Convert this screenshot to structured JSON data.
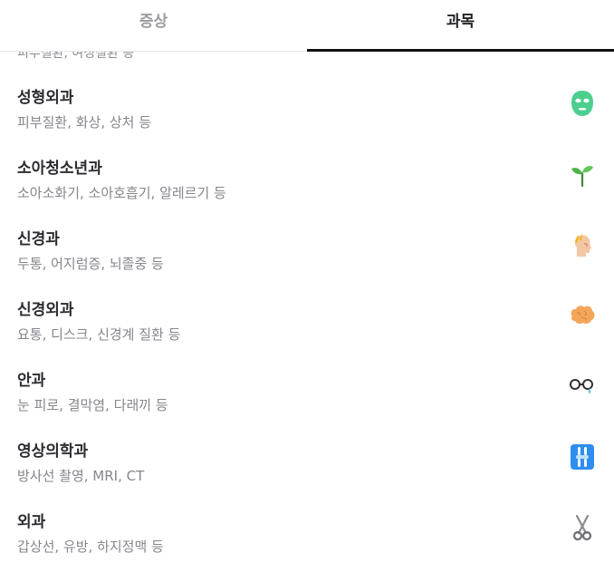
{
  "tabs": {
    "symptom": "증상",
    "department": "과목"
  },
  "partial_top": "피부질환, 여성질환 등",
  "departments": [
    {
      "name": "성형외과",
      "desc": "피부질환, 화상, 상처 등",
      "icon": "face-mask-icon"
    },
    {
      "name": "소아청소년과",
      "desc": "소아소화기, 소아호흡기, 알레르기 등",
      "icon": "sprout-icon"
    },
    {
      "name": "신경과",
      "desc": "두통, 어지럼증, 뇌졸중 등",
      "icon": "head-pain-icon"
    },
    {
      "name": "신경외과",
      "desc": "요통, 디스크, 신경계 질환 등",
      "icon": "brain-icon"
    },
    {
      "name": "안과",
      "desc": "눈 피로, 결막염, 다래끼 등",
      "icon": "eyeglasses-icon"
    },
    {
      "name": "영상의학과",
      "desc": "방사선 촬영, MRI, CT",
      "icon": "xray-icon"
    },
    {
      "name": "외과",
      "desc": "갑상선, 유방, 하지정맥 등",
      "icon": "scissors-icon"
    }
  ],
  "colors": {
    "active_tab_underline": "#111111",
    "inactive_tab_text": "#9b9ba1",
    "description_text": "#86868d"
  }
}
